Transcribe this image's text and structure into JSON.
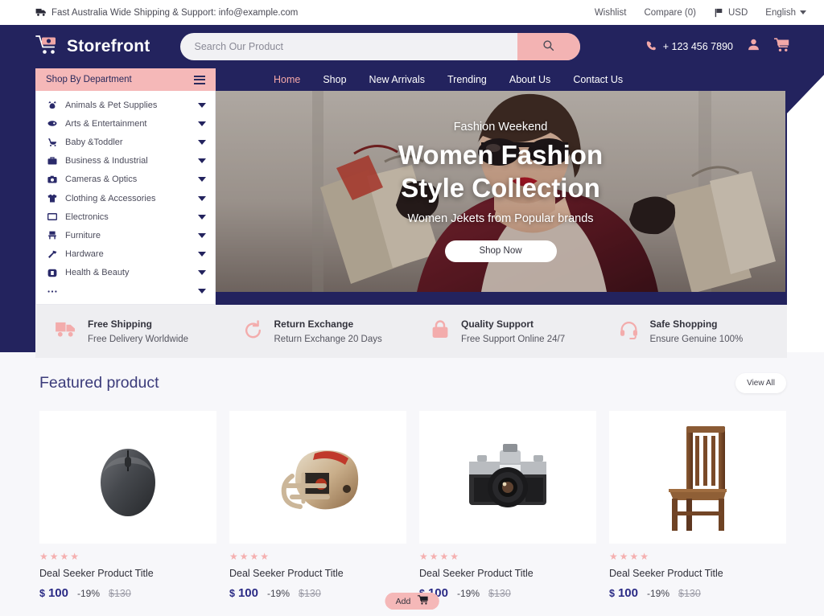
{
  "topbar": {
    "truck_icon": "truck-icon",
    "message": "Fast Australia Wide Shipping & Support: info@example.com",
    "wishlist": "Wishlist",
    "compare": "Compare (0)",
    "flag_icon": "flag-icon",
    "currency": "USD",
    "language": "English"
  },
  "header": {
    "logo_icon": "shopping-cart-logo-icon",
    "logo_text": "Storefront",
    "search_placeholder": "Search Our Product",
    "search_value": "",
    "search_icon": "search-icon",
    "phone_icon": "phone-icon",
    "phone": "+ 123 456 7890",
    "account_icon": "user-account-icon",
    "cart_icon": "shopping-cart-icon"
  },
  "nav": {
    "dept_label": "Shop By Department",
    "menu_icon": "hamburger-menu-icon",
    "items": [
      {
        "label": "Home",
        "active": true
      },
      {
        "label": "Shop",
        "active": false
      },
      {
        "label": "New Arrivals",
        "active": false
      },
      {
        "label": "Trending",
        "active": false
      },
      {
        "label": "About Us",
        "active": false
      },
      {
        "label": "Contact Us",
        "active": false
      }
    ]
  },
  "departments": [
    {
      "label": "Animals & Pet Supplies",
      "icon": "pet-icon"
    },
    {
      "label": "Arts & Entertainment",
      "icon": "art-icon"
    },
    {
      "label": "Baby &Toddler",
      "icon": "stroller-icon"
    },
    {
      "label": "Business & Industrial",
      "icon": "briefcase-icon"
    },
    {
      "label": "Cameras & Optics",
      "icon": "camera-icon"
    },
    {
      "label": "Clothing & Accessories",
      "icon": "shirt-icon"
    },
    {
      "label": "Electronics",
      "icon": "monitor-icon"
    },
    {
      "label": "Furniture",
      "icon": "chair-icon"
    },
    {
      "label": "Hardware",
      "icon": "hammer-icon"
    },
    {
      "label": "Health & Beauty",
      "icon": "health-icon"
    },
    {
      "label": "...",
      "icon": "ellipsis-icon"
    }
  ],
  "hero": {
    "kicker": "Fashion Weekend",
    "title_line1": "Women Fashion",
    "title_line2": "Style Collection",
    "subtitle": "Women Jekets from  Popular brands",
    "cta": "Shop Now"
  },
  "services": [
    {
      "icon": "truck-icon",
      "title": "Free Shipping",
      "sub": "Free Delivery Worldwide"
    },
    {
      "icon": "return-icon",
      "title": "Return Exchange",
      "sub": "Return Exchange 20 Days"
    },
    {
      "icon": "bag-icon",
      "title": "Quality Support",
      "sub": "Free Support Online 24/7"
    },
    {
      "icon": "headset-icon",
      "title": "Safe Shopping",
      "sub": "Ensure Genuine 100%"
    }
  ],
  "featured": {
    "title": "Featured product",
    "view_all": "View All",
    "add_label": "Add",
    "add_icon": "cart-add-icon",
    "products": [
      {
        "image": "computer-mouse",
        "rating": 4,
        "title": "Deal Seeker Product Title",
        "currency": "$",
        "price": "100",
        "discount": "-19%",
        "old_price": "$130"
      },
      {
        "image": "football-helmet",
        "rating": 4,
        "title": "Deal Seeker Product Title",
        "currency": "$",
        "price": "100",
        "discount": "-19%",
        "old_price": "$130"
      },
      {
        "image": "slr-camera",
        "rating": 4,
        "title": "Deal Seeker Product Title",
        "currency": "$",
        "price": "100",
        "discount": "-19%",
        "old_price": "$130"
      },
      {
        "image": "wooden-chair",
        "rating": 4,
        "title": "Deal Seeker Product Title",
        "currency": "$",
        "price": "100",
        "discount": "-19%",
        "old_price": "$130"
      }
    ]
  },
  "colors": {
    "navy": "#23235e",
    "pink": "#f5b8b8",
    "pink_dark": "#f3a6a6",
    "page_bg": "#f7f7fa",
    "strip_bg": "#eeeef1",
    "price_blue": "#2a2a85"
  }
}
